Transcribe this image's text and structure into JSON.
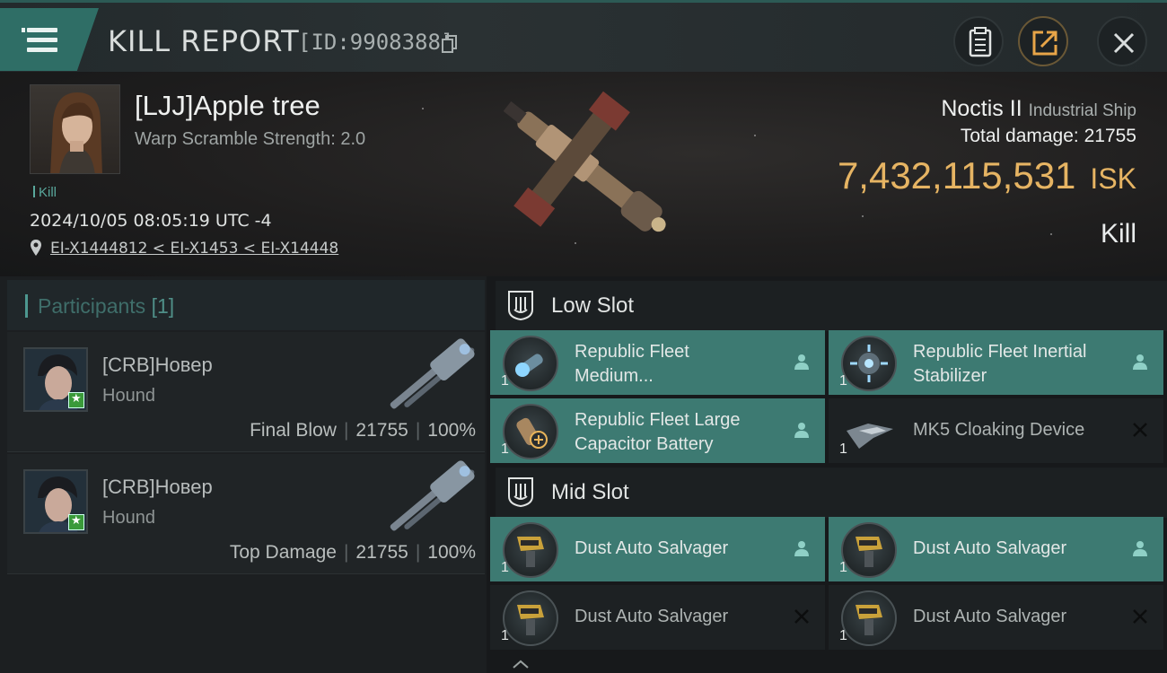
{
  "header": {
    "title": "KILL REPORT",
    "report_id": "[ID:9908388]",
    "buttons": [
      "clipboard-icon",
      "share-icon",
      "close-icon"
    ]
  },
  "victim": {
    "name": "[LJJ]Apple tree",
    "warp_scramble": "Warp Scramble Strength: 2.0",
    "type": "Kill",
    "datetime": "2024/10/05 08:05:19 UTC -4",
    "location": "EI-X1444812 < EI-X1453 < EI-X14448"
  },
  "ship": {
    "name": "Noctis II",
    "class": "Industrial Ship",
    "total_damage_label": "Total damage:",
    "total_damage": "21755",
    "isk_value": "7,432,115,531",
    "isk_unit": "ISK",
    "result": "Kill"
  },
  "participants": {
    "title": "Participants",
    "count": "[1]",
    "rows": [
      {
        "name": "[CRB]Новер",
        "ship": "Hound",
        "role": "Final Blow",
        "damage": "21755",
        "percent": "100%"
      },
      {
        "name": "[CRB]Новер",
        "ship": "Hound",
        "role": "Top Damage",
        "damage": "21755",
        "percent": "100%"
      }
    ]
  },
  "slots": {
    "low_title": "Low Slot",
    "mid_title": "Mid Slot",
    "low": [
      {
        "name": "Republic Fleet Medium...",
        "line1": "Republic Fleet",
        "line2": "Medium...",
        "qty": "1",
        "status": "dropped"
      },
      {
        "name": "Republic Fleet Inertial Stabilizer",
        "line1": "Republic Fleet Inertial",
        "line2": "Stabilizer",
        "qty": "1",
        "status": "dropped"
      },
      {
        "name": "Republic Fleet Large Capacitor Battery",
        "line1": "Republic Fleet Large",
        "line2": "Capacitor Battery",
        "qty": "1",
        "status": "dropped"
      },
      {
        "name": "MK5 Cloaking Device",
        "line1": "MK5 Cloaking Device",
        "line2": "",
        "qty": "1",
        "status": "destroyed"
      }
    ],
    "mid": [
      {
        "name": "Dust Auto Salvager",
        "qty": "1",
        "status": "dropped"
      },
      {
        "name": "Dust Auto Salvager",
        "qty": "1",
        "status": "dropped"
      },
      {
        "name": "Dust Auto Salvager",
        "qty": "1",
        "status": "destroyed"
      },
      {
        "name": "Dust Auto Salvager",
        "qty": "1",
        "status": "destroyed"
      }
    ]
  },
  "colors": {
    "accent": "#3d7a72",
    "isk": "#e6b463",
    "kill_label": "#59a89c"
  }
}
